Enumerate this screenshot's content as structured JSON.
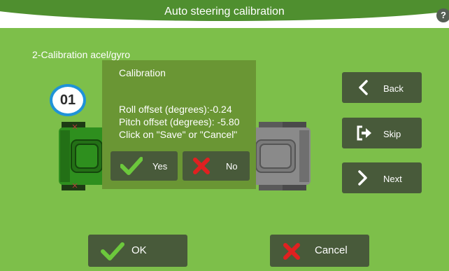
{
  "header": {
    "title": "Auto steering calibration",
    "help_label": "?"
  },
  "step": {
    "label": "2-Calibration acel/gyro",
    "number": "01"
  },
  "dialog": {
    "title": "Calibration",
    "roll_offset": "Roll offset (degrees):-0.24",
    "pitch_offset": "Pitch offset (degrees): -5.80",
    "instruction": "Click on \"Save\" or \"Cancel\"",
    "yes_label": "Yes",
    "no_label": "No"
  },
  "side_buttons": {
    "back_label": "Back",
    "skip_label": "Skip",
    "next_label": "Next"
  },
  "bottom_buttons": {
    "ok_label": "OK",
    "cancel_label": "Cancel"
  },
  "icons": {
    "check": "check-icon",
    "cross": "cross-icon",
    "chevron_left": "chevron-left-icon",
    "chevron_right": "chevron-right-icon",
    "skip": "exit-arrow-icon",
    "help": "help-icon"
  },
  "colors": {
    "background": "#7dbf4a",
    "header": "#4f8f2f",
    "dialog": "#6a9634",
    "button": "#485a3a",
    "check": "#6cc83c",
    "cross": "#e02020",
    "badge_border": "#1f93d8",
    "tractor_active": "#2e8f1e",
    "tractor_inactive": "#8a8a8a"
  }
}
